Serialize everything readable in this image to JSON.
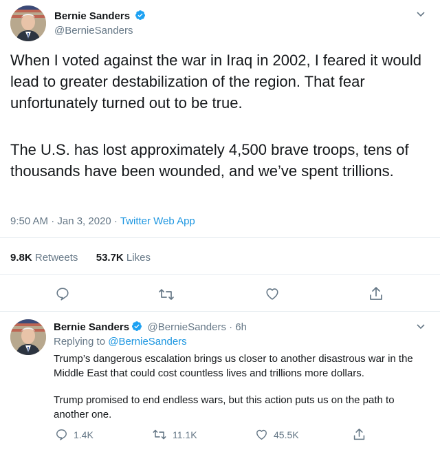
{
  "main_tweet": {
    "display_name": "Bernie Sanders",
    "handle": "@BernieSanders",
    "paragraph1": "When I voted against the war in Iraq in 2002, I feared it would lead to greater destabilization of the region. That fear unfortunately turned out to be true.",
    "paragraph2": "The U.S. has lost approximately 4,500 brave troops, tens of thousands have been wounded, and we’ve spent trillions.",
    "time": "9:50 AM · Jan 3, 2020 · ",
    "source": "Twitter Web App",
    "retweets_count": "9.8K",
    "retweets_label": " Retweets",
    "likes_count": "53.7K",
    "likes_label": " Likes"
  },
  "reply_tweet": {
    "display_name": "Bernie Sanders",
    "handle_time": "@BernieSanders · 6h",
    "replying_prefix": "Replying to ",
    "replying_handle": "@BernieSanders",
    "paragraph1": "Trump’s dangerous escalation brings us closer to another disastrous war in the Middle East that could cost countless lives and trillions more dollars.",
    "paragraph2": "Trump promised to end endless wars, but this action puts us on the path to another one.",
    "reply_count": "1.4K",
    "retweet_count": "11.1K",
    "like_count": "45.5K"
  },
  "colors": {
    "verified": "#1da1f2",
    "link": "#1b95e0",
    "muted": "#657786",
    "divider": "#e6ecf0"
  },
  "icons": [
    "verified-badge-icon",
    "chevron-down-icon",
    "reply-icon",
    "retweet-icon",
    "like-icon",
    "share-icon"
  ]
}
